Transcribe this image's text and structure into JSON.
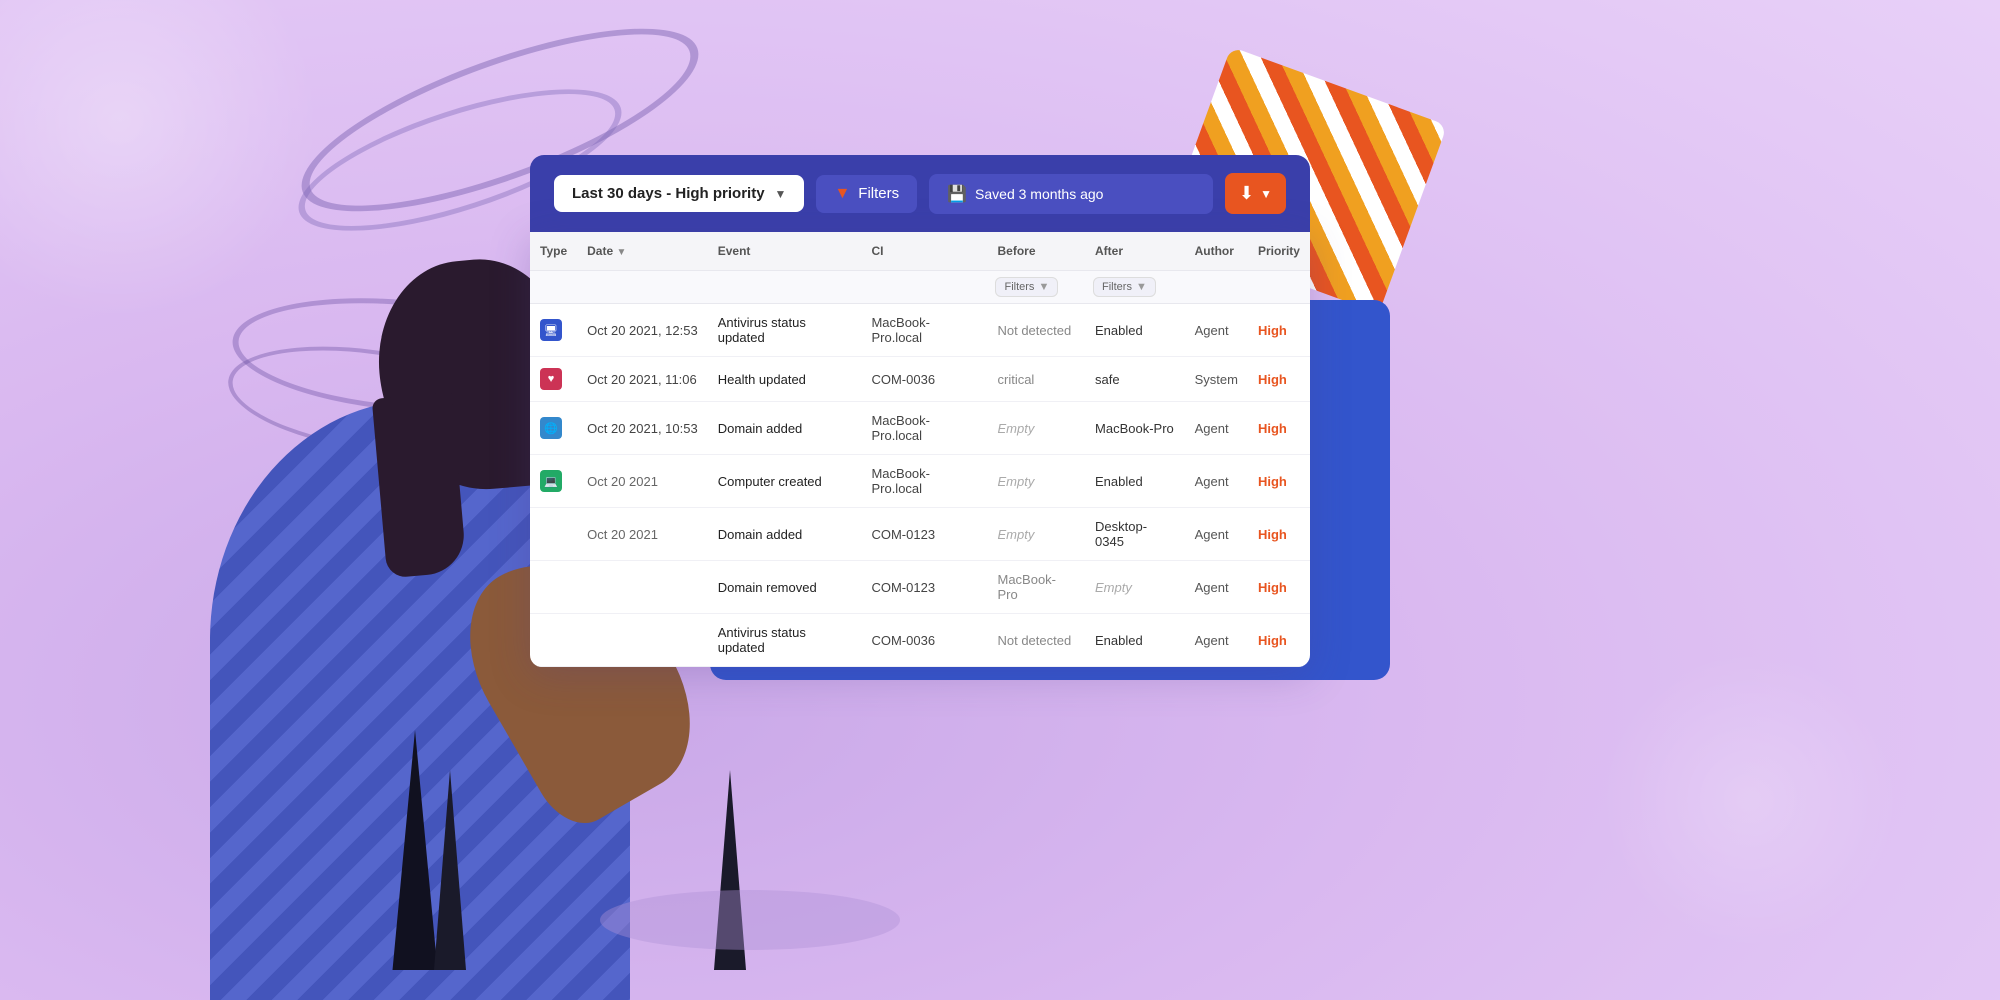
{
  "background": {
    "color": "#d9b8f0"
  },
  "filter_bar": {
    "dropdown_label": "Last 30 days - High priority",
    "filters_label": "Filters",
    "saved_label": "Saved 3 months ago",
    "download_icon": "⬇",
    "chevron": "▼"
  },
  "table": {
    "columns": [
      "Type",
      "Date",
      "Event",
      "CI",
      "Before",
      "After",
      "Author",
      "Priority"
    ],
    "filter_row": {
      "before_placeholder": "Filters",
      "after_placeholder": "Filters"
    },
    "rows": [
      {
        "type_icon": "🖥",
        "type_class": "icon-monitor",
        "date": "Oct 20 2021, 12:53",
        "event": "Antivirus status updated",
        "ci": "MacBook-Pro.local",
        "before": "Not detected",
        "after": "Enabled",
        "author": "Agent",
        "priority": "High"
      },
      {
        "type_icon": "♥",
        "type_class": "icon-heart",
        "date": "Oct 20 2021, 11:06",
        "event": "Health updated",
        "ci": "COM-0036",
        "before": "critical",
        "after": "safe",
        "author": "System",
        "priority": "High"
      },
      {
        "type_icon": "🌐",
        "type_class": "icon-domain",
        "date": "Oct 20 2021, 10:53",
        "event": "Domain added",
        "ci": "MacBook-Pro.local",
        "before": "Empty",
        "before_empty": true,
        "after": "MacBook-Pro",
        "author": "Agent",
        "priority": "High"
      },
      {
        "type_icon": "💻",
        "type_class": "icon-computer",
        "date": "Oct 20 2021",
        "date_partial": true,
        "event": "Computer created",
        "ci": "MacBook-Pro.local",
        "before": "Empty",
        "before_empty": true,
        "after": "Enabled",
        "author": "Agent",
        "priority": "High"
      },
      {
        "type_icon": "",
        "type_class": "",
        "date": "Oct 20 2021",
        "date_partial": true,
        "event": "Domain added",
        "ci": "COM-0123",
        "before": "Empty",
        "before_empty": true,
        "after": "Desktop-0345",
        "author": "Agent",
        "priority": "High"
      },
      {
        "type_icon": "",
        "type_class": "",
        "date": "",
        "event": "Domain removed",
        "ci": "COM-0123",
        "before": "MacBook-Pro",
        "after": "Empty",
        "after_empty": true,
        "author": "Agent",
        "priority": "High"
      },
      {
        "type_icon": "",
        "type_class": "",
        "date": "",
        "event": "Antivirus status updated",
        "ci": "COM-0036",
        "before": "Not detected",
        "after": "Enabled",
        "author": "Agent",
        "priority": "High"
      }
    ]
  }
}
